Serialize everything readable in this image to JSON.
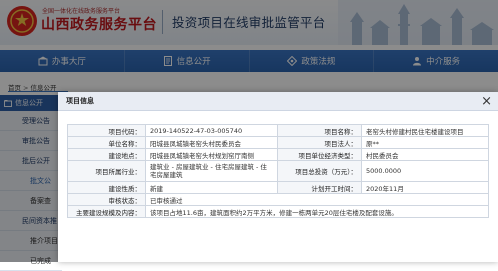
{
  "header": {
    "brand_sub": "全国一体化在线政务服务平台",
    "brand_main": "山西政务服务平台",
    "platform_title": "投资项目在线审批监管平台"
  },
  "nav": {
    "items": [
      {
        "label": "办事大厅",
        "icon": "building-icon"
      },
      {
        "label": "信息公开",
        "icon": "document-icon"
      },
      {
        "label": "政策法规",
        "icon": "law-icon"
      },
      {
        "label": "中介服务",
        "icon": "person-icon"
      }
    ]
  },
  "breadcrumb": {
    "home": "首页",
    "separator": ">",
    "current": "信息公开"
  },
  "sidebar": {
    "header": "信息公开",
    "items": [
      {
        "label": "受理公告"
      },
      {
        "label": "审批公告"
      },
      {
        "label": "批后公开"
      },
      {
        "label": "批文公"
      },
      {
        "label": "备案查"
      },
      {
        "label": "民间资本推"
      },
      {
        "label": "推介项目"
      },
      {
        "label": "已完成"
      }
    ]
  },
  "modal": {
    "title": "项目信息",
    "close": "×",
    "fields": {
      "project_code": {
        "label": "项目代码：",
        "value": "2019-140522-47-03-005740"
      },
      "project_name": {
        "label": "项目名称：",
        "value": "老窑头村修建村民住宅楼建设项目"
      },
      "unit_name": {
        "label": "单位名称：",
        "value": "阳城县凤城镇老窑头村民委员会"
      },
      "legal_person": {
        "label": "项目法人：",
        "value": "原**"
      },
      "location": {
        "label": "建设地点：",
        "value": "阳城县凤城镇老窑头村规划窑厅南侧"
      },
      "unit_type": {
        "label": "项目单位经济类型：",
        "value": "村民委员会"
      },
      "industry": {
        "label": "项目所属行业：",
        "value": "建筑业 - 房屋建筑业 - 住宅房屋建筑 - 住宅房屋建筑"
      },
      "investment": {
        "label": "项目总投资（万元）：",
        "value": "5000.0000"
      },
      "nature": {
        "label": "建设性质：",
        "value": "新建"
      },
      "start_time": {
        "label": "计划开工时间：",
        "value": "2020年11月"
      },
      "status": {
        "label": "审核状态：",
        "value": "已审核通过"
      },
      "content": {
        "label": "主要建设规模及内容：",
        "value": "该项目占地11.6亩，建筑面积约2万平方米，修建一栋两单元20层住宅楼及配套设施。"
      }
    }
  },
  "colors": {
    "brand_red": "#c0191e",
    "nav_blue": "#2b63ad",
    "title_navy": "#223c66"
  }
}
